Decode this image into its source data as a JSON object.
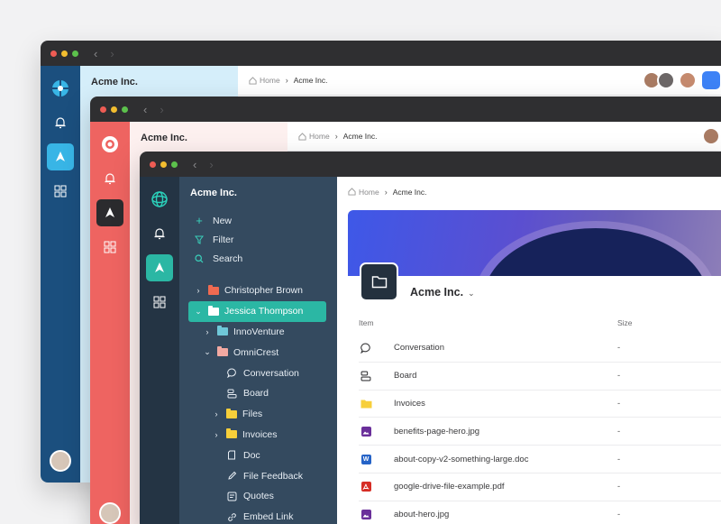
{
  "workspace": "Acme Inc.",
  "breadcrumb": {
    "home": "Home",
    "current": "Acme Inc."
  },
  "actions": [
    {
      "icon": "plus-icon",
      "label": "New"
    },
    {
      "icon": "filter-icon",
      "label": "Filter"
    },
    {
      "icon": "search-icon",
      "label": "Search"
    }
  ],
  "tree": [
    {
      "label": "Christopher Brown",
      "level": 0,
      "chevron": "right",
      "folder_color": "#ef6a51"
    },
    {
      "label": "Jessica Thompson",
      "level": 0,
      "chevron": "down",
      "folder_color": "#ffffff",
      "selected": true
    },
    {
      "label": "InnoVenture",
      "level": 1,
      "chevron": "right",
      "folder_color": "#6fc7d8"
    },
    {
      "label": "OmniCrest",
      "level": 1,
      "chevron": "down",
      "folder_color": "#f2a9a2"
    },
    {
      "label": "Conversation",
      "level": 2,
      "icon": "chat-bubble-icon"
    },
    {
      "label": "Board",
      "level": 2,
      "icon": "board-icon"
    },
    {
      "label": "Files",
      "level": 2,
      "chevron": "right",
      "folder_color": "#f7cf3a"
    },
    {
      "label": "Invoices",
      "level": 2,
      "chevron": "right",
      "folder_color": "#f7cf3a"
    },
    {
      "label": "Doc",
      "level": 2,
      "icon": "doc-icon"
    },
    {
      "label": "File Feedback",
      "level": 2,
      "icon": "pencil-icon"
    },
    {
      "label": "Quotes",
      "level": 2,
      "icon": "quotes-icon"
    },
    {
      "label": "Embed Link",
      "level": 2,
      "icon": "link-icon"
    }
  ],
  "table": {
    "col_item": "Item",
    "col_size": "Size",
    "rows": [
      {
        "name": "Conversation",
        "size": "-",
        "icon": "chat-bubble-icon"
      },
      {
        "name": "Board",
        "size": "-",
        "icon": "board-icon"
      },
      {
        "name": "Invoices",
        "size": "-",
        "icon": "folder-icon"
      },
      {
        "name": "benefits-page-hero.jpg",
        "size": "-",
        "icon": "image-file-icon"
      },
      {
        "name": "about-copy-v2-something-large.doc",
        "size": "-",
        "icon": "word-file-icon",
        "badge": "W"
      },
      {
        "name": "google-drive-file-example.pdf",
        "size": "-",
        "icon": "pdf-file-icon"
      },
      {
        "name": "about-hero.jpg",
        "size": "-",
        "icon": "image-file-icon"
      }
    ]
  },
  "colors": {
    "teal_accent": "#2bb7a4",
    "blue_rail": "#1b4f7e",
    "red_rail": "#ee6461",
    "dark_rail": "#243444",
    "dark_panel": "#344a5f"
  }
}
